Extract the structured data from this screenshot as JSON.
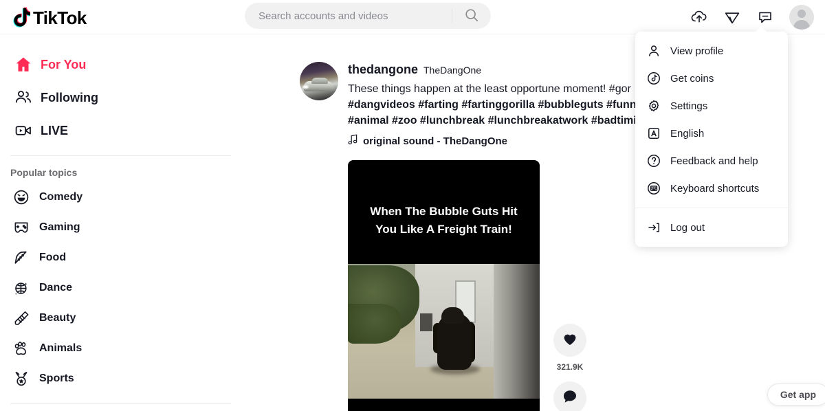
{
  "app": {
    "name": "TikTok",
    "logo_icon": "tiktok-note-icon"
  },
  "search": {
    "placeholder": "Search accounts and videos",
    "value": "",
    "icon": "search-icon"
  },
  "header": {
    "actions": [
      {
        "name": "upload-icon",
        "label": "Upload"
      },
      {
        "name": "send-message-icon",
        "label": "Messages"
      },
      {
        "name": "inbox-icon",
        "label": "Inbox"
      }
    ],
    "avatar": {
      "name": "profile-avatar",
      "label": "Profile"
    }
  },
  "sidebar": {
    "nav": [
      {
        "label": "For You",
        "icon": "home-icon",
        "active": true
      },
      {
        "label": "Following",
        "icon": "people-icon",
        "active": false
      },
      {
        "label": "LIVE",
        "icon": "live-video-icon",
        "active": false
      }
    ],
    "topics_heading": "Popular topics",
    "topics": [
      {
        "label": "Comedy",
        "icon": "smiley-icon"
      },
      {
        "label": "Gaming",
        "icon": "gamepad-icon"
      },
      {
        "label": "Food",
        "icon": "pizza-slice-icon"
      },
      {
        "label": "Dance",
        "icon": "disco-ball-icon"
      },
      {
        "label": "Beauty",
        "icon": "comb-icon"
      },
      {
        "label": "Animals",
        "icon": "paw-icon"
      },
      {
        "label": "Sports",
        "icon": "medal-icon"
      }
    ]
  },
  "post": {
    "author_handle": "thedangone",
    "author_name": "TheDangOne",
    "caption_line1": "These things happen at the least opportune moment! #gor",
    "caption_line2": "#dangvideos #farting #fartinggorilla #bubbleguts #funny",
    "caption_line3": "#animal #zoo #lunchbreak #lunchbreakatwork #badtimin",
    "sound": "original sound - TheDangOne",
    "sound_icon": "music-note-icon",
    "video_overlay_line1": "When The Bubble Guts Hit",
    "video_overlay_line2": "You Like A Freight Train!",
    "actions": [
      {
        "name": "like-button",
        "icon": "heart-icon",
        "count": "321.9K"
      },
      {
        "name": "comment-button",
        "icon": "comment-icon",
        "count": ""
      }
    ]
  },
  "profile_menu": {
    "items": [
      {
        "label": "View profile",
        "icon": "person-icon",
        "name": "menu-item-view-profile"
      },
      {
        "label": "Get coins",
        "icon": "coin-icon",
        "name": "menu-item-get-coins"
      },
      {
        "label": "Settings",
        "icon": "gear-icon",
        "name": "menu-item-settings"
      },
      {
        "label": "English",
        "icon": "language-icon",
        "name": "menu-item-language"
      },
      {
        "label": "Feedback and help",
        "icon": "question-circle-icon",
        "name": "menu-item-feedback"
      },
      {
        "label": "Keyboard shortcuts",
        "icon": "keyboard-icon",
        "name": "menu-item-keyboard-shortcuts"
      }
    ],
    "logout": {
      "label": "Log out",
      "icon": "logout-icon",
      "name": "menu-item-log-out"
    }
  },
  "get_app": {
    "label": "Get app"
  },
  "colors": {
    "brand_pink": "#fe2c55",
    "brand_cyan": "#25f4ee",
    "text": "#161823",
    "muted": "#8a8b91",
    "surface": "#f1f1f2"
  }
}
